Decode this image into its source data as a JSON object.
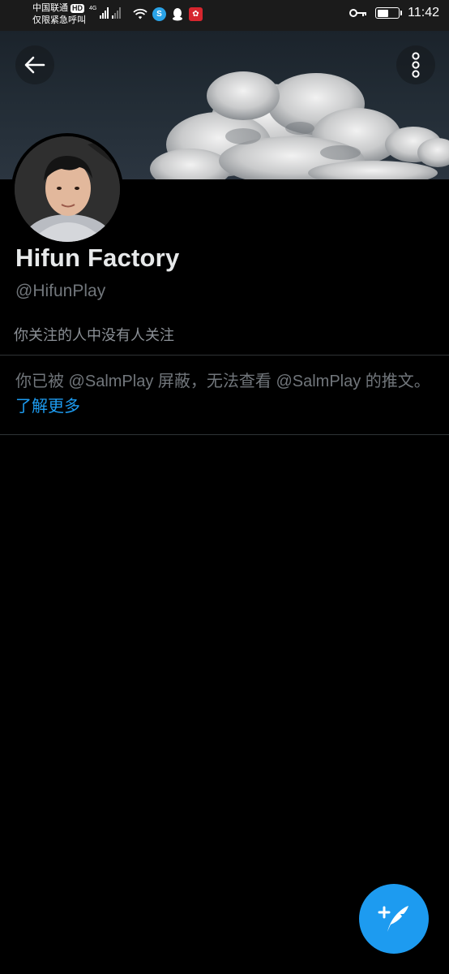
{
  "status_bar": {
    "carrier": "中国联通",
    "hd": "HD",
    "emergency": "仅限紧急呼叫",
    "network": "4G",
    "time": "11:42",
    "battery_level": 0.55
  },
  "header": {
    "back_icon": "arrow-left-icon",
    "more_icon": "more-vertical-icon"
  },
  "profile": {
    "display_name": "Hifun Factory",
    "handle": "@HifunPlay",
    "followers_note": "你关注的人中没有人关注"
  },
  "blocked": {
    "message": "你已被 @SalmPlay 屏蔽，无法查看 @SalmPlay 的推文。",
    "learn_more": "了解更多"
  },
  "fab": {
    "icon": "compose-tweet-icon"
  },
  "colors": {
    "background": "#000000",
    "accent": "#1d9bf0",
    "secondary_text": "#71767b",
    "divider": "#2f3336"
  }
}
